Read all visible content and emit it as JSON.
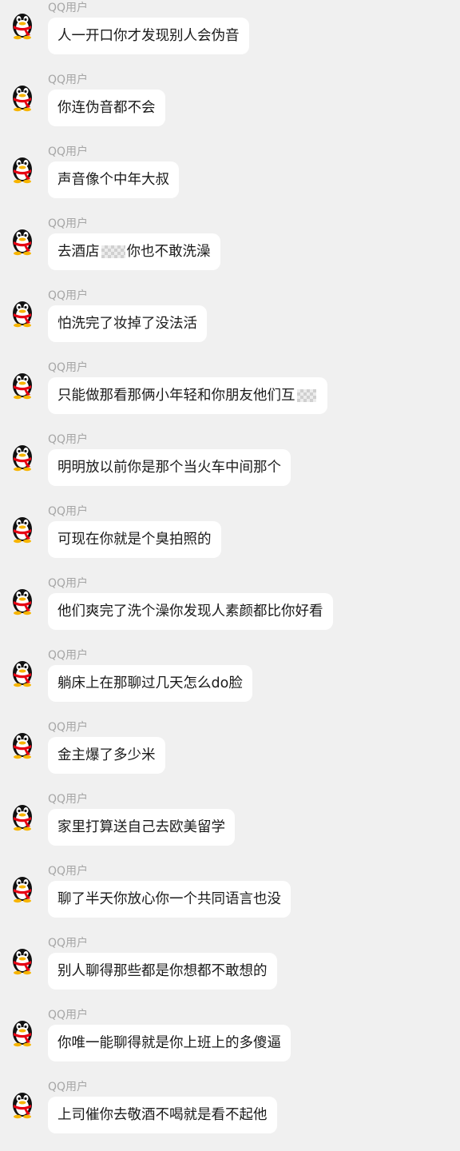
{
  "sender_name": "QQ用户",
  "messages": [
    {
      "text": "人一开口你才发现别人会伪音",
      "after": ""
    },
    {
      "text": "你连伪音都不会",
      "after": ""
    },
    {
      "text": "声音像个中年大叔",
      "after": ""
    },
    {
      "text": "去酒店",
      "after": "你也不敢洗澡"
    },
    {
      "text": "怕洗完了妆掉了没法活",
      "after": ""
    },
    {
      "text": "只能做那看那俩小年轻和你朋友他们互",
      "after": ""
    },
    {
      "text": "明明放以前你是那个当火车中间那个",
      "after": ""
    },
    {
      "text": "可现在你就是个臭拍照的",
      "after": ""
    },
    {
      "text": "他们爽完了洗个澡你发现人素颜都比你好看",
      "after": ""
    },
    {
      "text": "躺床上在那聊过几天怎么do脸",
      "after": ""
    },
    {
      "text": "金主爆了多少米",
      "after": ""
    },
    {
      "text": "家里打算送自己去欧美留学",
      "after": ""
    },
    {
      "text": "聊了半天你放心你一个共同语言也没",
      "after": ""
    },
    {
      "text": "别人聊得那些都是你想都不敢想的",
      "after": ""
    },
    {
      "text": "你唯一能聊得就是你上班上的多傻逼",
      "after": ""
    },
    {
      "text": "上司催你去敬酒不喝就是看不起他",
      "after": ""
    }
  ],
  "colors": {
    "background": "#f0f0f0",
    "bubble": "#ffffff",
    "sender": "#a6a6a6",
    "text": "#1a1a1a"
  },
  "icons": {
    "avatar": "qq-penguin-icon",
    "censor": "pixelated-mosaic"
  }
}
